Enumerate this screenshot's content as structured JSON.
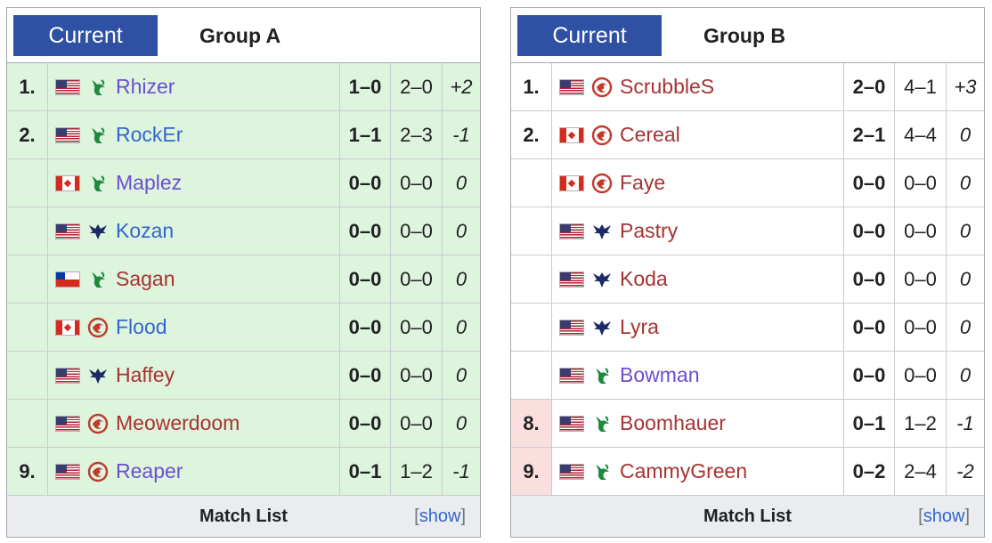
{
  "colors": {
    "tab_active": "#2f51a4",
    "advance_green": "#ddf4dd",
    "eliminated_red": "#fbdfdf",
    "protoss_name": "#7f3fbf",
    "terran_name": "#3366cc",
    "zerg_name": "#a83232",
    "race_zerg_icon": "#c0392b",
    "race_protoss_icon": "#1e8a3e",
    "race_terran_icon": "#1c2a66"
  },
  "groups": [
    {
      "tab_label": "Current",
      "title": "Group A",
      "footer_label": "Match List",
      "show_open": "[",
      "show_label": "show",
      "show_close": "]",
      "rows": [
        {
          "rank": "1.",
          "flag": "us",
          "race": "protoss",
          "name": "Rhizer",
          "match": "1–0",
          "game": "2–0",
          "diff": "+2",
          "bg": "green",
          "name_color": "#6b4fcf"
        },
        {
          "rank": "2.",
          "flag": "us",
          "race": "protoss",
          "name": "RockEr",
          "match": "1–1",
          "game": "2–3",
          "diff": "-1",
          "bg": "green",
          "name_color": "#3366cc"
        },
        {
          "rank": "",
          "flag": "ca",
          "race": "protoss",
          "name": "Maplez",
          "match": "0–0",
          "game": "0–0",
          "diff": "0",
          "bg": "green",
          "name_color": "#6b4fcf"
        },
        {
          "rank": "",
          "flag": "us",
          "race": "terran",
          "name": "Kozan",
          "match": "0–0",
          "game": "0–0",
          "diff": "0",
          "bg": "green",
          "name_color": "#3366cc"
        },
        {
          "rank": "",
          "flag": "cl",
          "race": "protoss",
          "name": "Sagan",
          "match": "0–0",
          "game": "0–0",
          "diff": "0",
          "bg": "green",
          "name_color": "#a83232"
        },
        {
          "rank": "",
          "flag": "ca",
          "race": "zerg",
          "name": "Flood",
          "match": "0–0",
          "game": "0–0",
          "diff": "0",
          "bg": "green",
          "name_color": "#3366cc"
        },
        {
          "rank": "",
          "flag": "us",
          "race": "terran",
          "name": "Haffey",
          "match": "0–0",
          "game": "0–0",
          "diff": "0",
          "bg": "green",
          "name_color": "#a83232"
        },
        {
          "rank": "",
          "flag": "us",
          "race": "zerg",
          "name": "Meowerdoom",
          "match": "0–0",
          "game": "0–0",
          "diff": "0",
          "bg": "green",
          "name_color": "#a83232"
        },
        {
          "rank": "9.",
          "flag": "us",
          "race": "zerg",
          "name": "Reaper",
          "match": "0–1",
          "game": "1–2",
          "diff": "-1",
          "bg": "green",
          "name_color": "#6b4fcf"
        }
      ]
    },
    {
      "tab_label": "Current",
      "title": "Group B",
      "footer_label": "Match List",
      "show_open": "[",
      "show_label": "show",
      "show_close": "]",
      "rows": [
        {
          "rank": "1.",
          "flag": "us",
          "race": "zerg",
          "name": "ScrubbleS",
          "match": "2–0",
          "game": "4–1",
          "diff": "+3",
          "bg": "white",
          "name_color": "#a83232"
        },
        {
          "rank": "2.",
          "flag": "ca",
          "race": "zerg",
          "name": "Cereal",
          "match": "2–1",
          "game": "4–4",
          "diff": "0",
          "bg": "white",
          "name_color": "#a83232"
        },
        {
          "rank": "",
          "flag": "ca",
          "race": "zerg",
          "name": "Faye",
          "match": "0–0",
          "game": "0–0",
          "diff": "0",
          "bg": "white",
          "name_color": "#a83232"
        },
        {
          "rank": "",
          "flag": "us",
          "race": "terran",
          "name": "Pastry",
          "match": "0–0",
          "game": "0–0",
          "diff": "0",
          "bg": "white",
          "name_color": "#a83232"
        },
        {
          "rank": "",
          "flag": "us",
          "race": "terran",
          "name": "Koda",
          "match": "0–0",
          "game": "0–0",
          "diff": "0",
          "bg": "white",
          "name_color": "#a83232"
        },
        {
          "rank": "",
          "flag": "us",
          "race": "terran",
          "name": "Lyra",
          "match": "0–0",
          "game": "0–0",
          "diff": "0",
          "bg": "white",
          "name_color": "#a83232"
        },
        {
          "rank": "",
          "flag": "us",
          "race": "protoss",
          "name": "Bowman",
          "match": "0–0",
          "game": "0–0",
          "diff": "0",
          "bg": "white",
          "name_color": "#6b4fcf"
        },
        {
          "rank": "8.",
          "flag": "us",
          "race": "protoss",
          "name": "Boomhauer",
          "match": "0–1",
          "game": "1–2",
          "diff": "-1",
          "bg": "red",
          "name_color": "#a83232"
        },
        {
          "rank": "9.",
          "flag": "us",
          "race": "protoss",
          "name": "CammyGreen",
          "match": "0–2",
          "game": "2–4",
          "diff": "-2",
          "bg": "red",
          "name_color": "#a83232"
        }
      ]
    }
  ]
}
